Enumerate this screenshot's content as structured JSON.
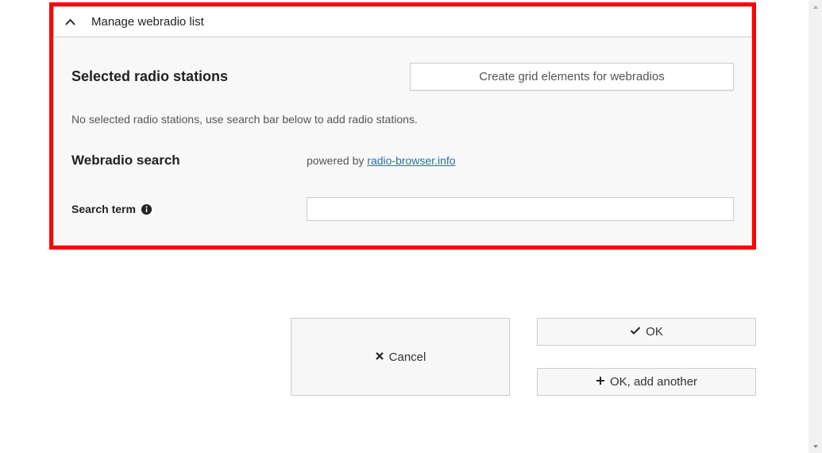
{
  "accordion": {
    "title": "Manage webradio list"
  },
  "section": {
    "selected_heading": "Selected radio stations",
    "create_button": "Create grid elements for webradios",
    "no_stations_msg": "No selected radio stations, use search bar below to add radio stations.",
    "webradio_search_heading": "Webradio search",
    "powered_by_text": "powered by ",
    "powered_by_link_label": "radio-browser.info",
    "search_label": "Search term"
  },
  "buttons": {
    "cancel": "Cancel",
    "ok": "OK",
    "ok_add_another": "OK, add another"
  }
}
